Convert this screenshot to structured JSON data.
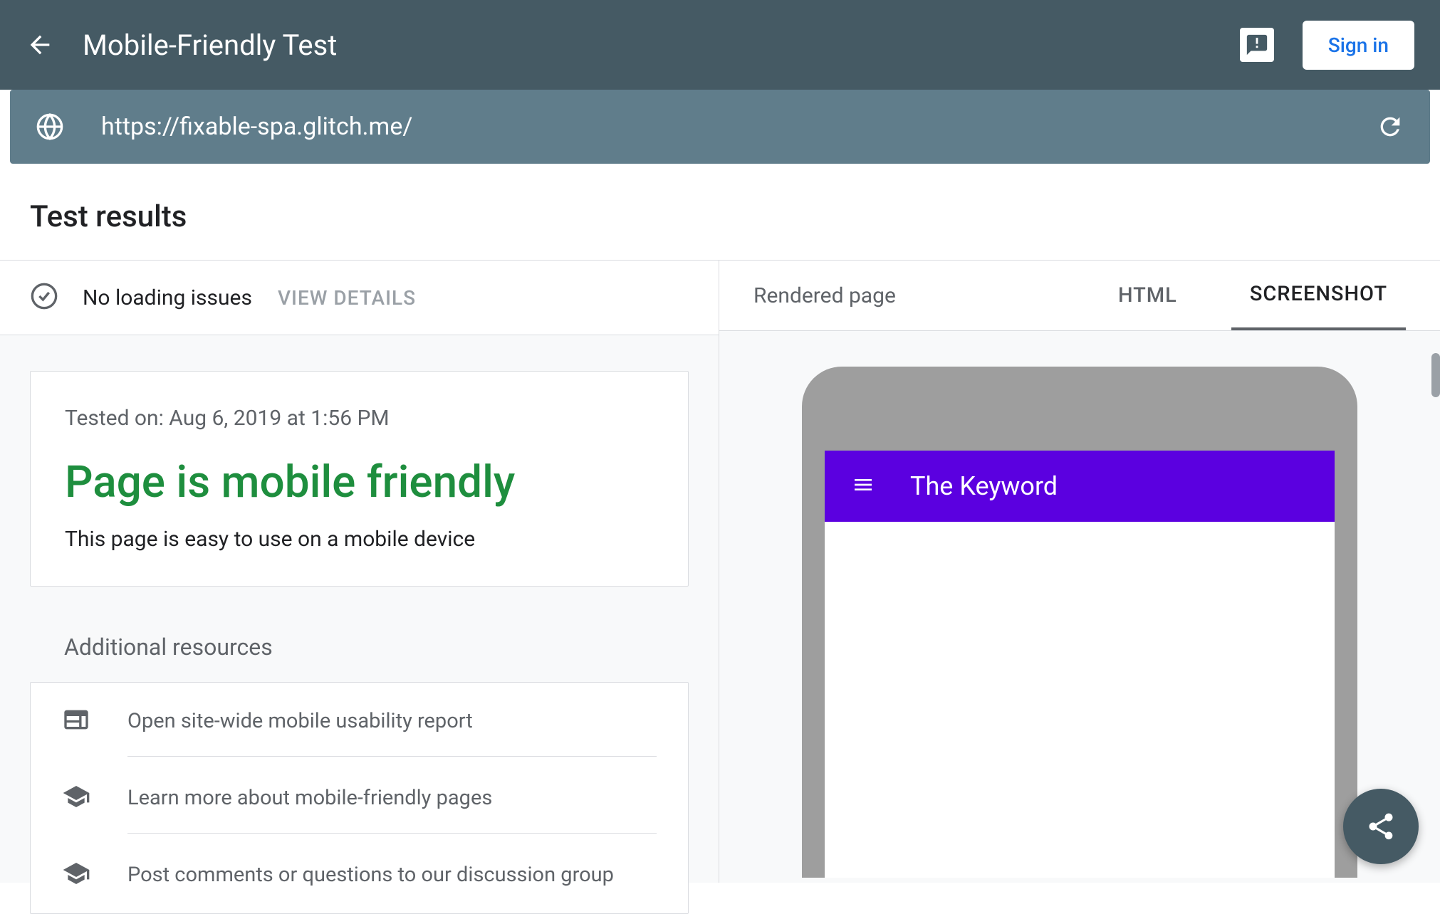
{
  "header": {
    "title": "Mobile-Friendly Test",
    "signin_label": "Sign in"
  },
  "urlbar": {
    "url": "https://fixable-spa.glitch.me/"
  },
  "results": {
    "section_title": "Test results",
    "status_text": "No loading issues",
    "view_details_label": "VIEW DETAILS",
    "tested_on": "Tested on: Aug 6, 2019 at 1:56 PM",
    "verdict": "Page is mobile friendly",
    "verdict_sub": "This page is easy to use on a mobile device"
  },
  "resources": {
    "heading": "Additional resources",
    "items": [
      {
        "label": "Open site-wide mobile usability report"
      },
      {
        "label": "Learn more about mobile-friendly pages"
      },
      {
        "label": "Post comments or questions to our discussion group"
      }
    ]
  },
  "right": {
    "rendered_label": "Rendered page",
    "tab_html": "HTML",
    "tab_screenshot": "SCREENSHOT",
    "preview_title": "The Keyword"
  }
}
